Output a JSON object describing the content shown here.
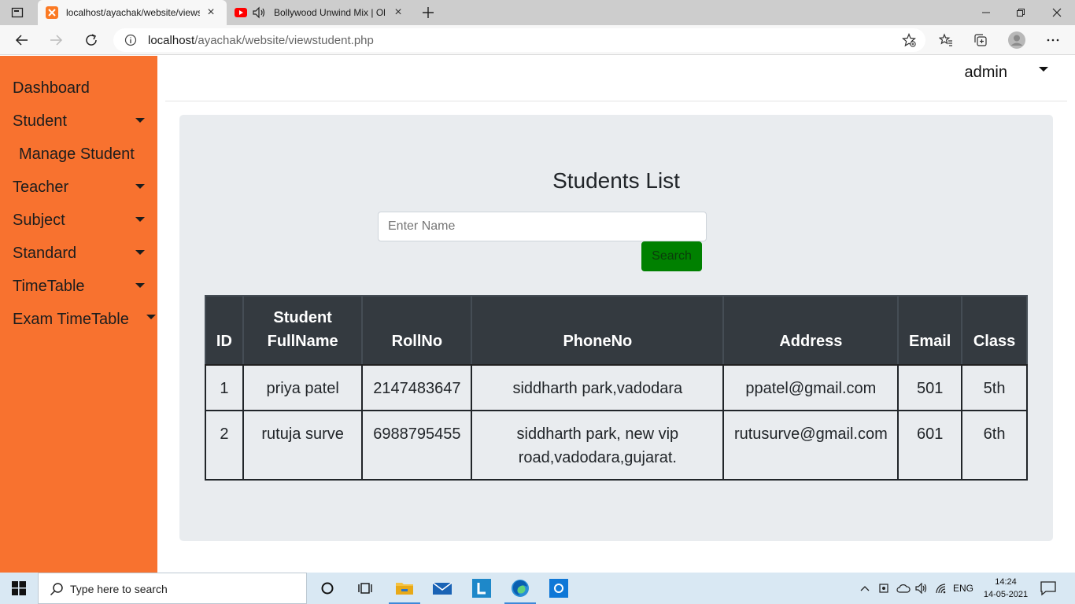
{
  "browser": {
    "tabs": [
      {
        "title": "localhost/ayachak/website/views",
        "active": true
      },
      {
        "title": "Bollywood Unwind Mix | Ol",
        "active": false
      }
    ],
    "url_host": "localhost",
    "url_path": "/ayachak/website/viewstudent.php"
  },
  "sidebar": {
    "items": [
      {
        "label": "Dashboard"
      },
      {
        "label": "Student"
      },
      {
        "label": "Manage Student"
      },
      {
        "label": "Teacher"
      },
      {
        "label": "Subject"
      },
      {
        "label": "Standard"
      },
      {
        "label": "TimeTable"
      },
      {
        "label": "Exam TimeTable"
      }
    ]
  },
  "topbar": {
    "user": "admin"
  },
  "main": {
    "title": "Students List",
    "search_placeholder": "Enter Name",
    "search_button": "Search",
    "table": {
      "headers": [
        "ID",
        "Student FullName",
        "RollNo",
        "PhoneNo",
        "Address",
        "Email",
        "Class"
      ],
      "rows": [
        [
          "1",
          "priya patel",
          "2147483647",
          "siddharth park,vadodara",
          "ppatel@gmail.com",
          "501",
          "5th"
        ],
        [
          "2",
          "rutuja surve",
          "6988795455",
          "siddharth park, new vip road,vadodara,gujarat.",
          "rutusurve@gmail.com",
          "601",
          "6th"
        ]
      ]
    }
  },
  "taskbar": {
    "search_placeholder": "Type here to search",
    "language": "ENG",
    "time": "14:24",
    "date": "14-05-2021"
  },
  "colors": {
    "sidebar": "#f8722f",
    "panel": "#e9ecef",
    "table_header": "#343a40",
    "search_button": "#008000"
  }
}
